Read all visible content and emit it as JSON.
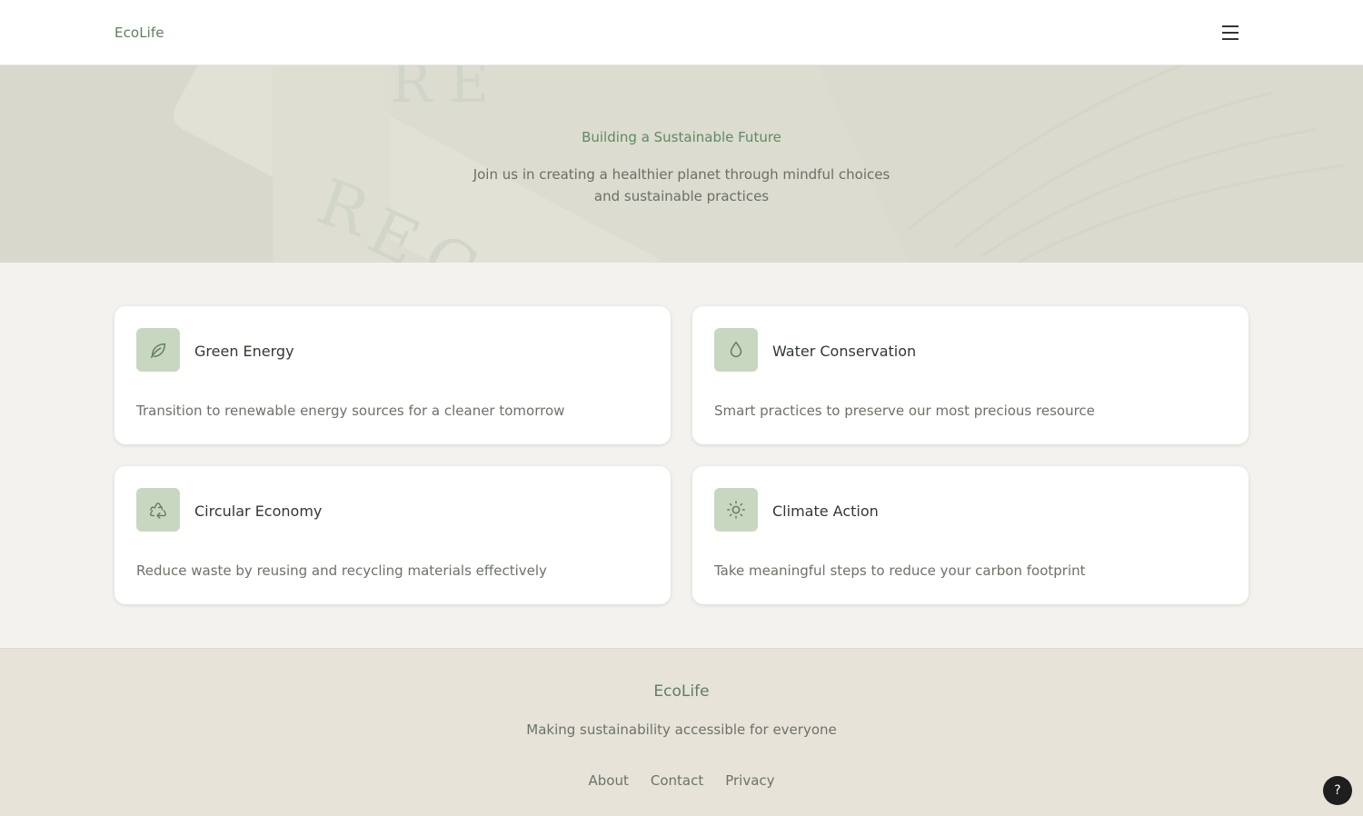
{
  "header": {
    "logo": "EcoLife"
  },
  "hero": {
    "title": "Building a Sustainable Future",
    "subtitle": "Join us in creating a healthier planet through mindful choices and sustainable practices"
  },
  "cards": [
    {
      "icon": "leaf-icon",
      "title": "Green Energy",
      "description": "Transition to renewable energy sources for a cleaner tomorrow"
    },
    {
      "icon": "water-drop-icon",
      "title": "Water Conservation",
      "description": "Smart practices to preserve our most precious resource"
    },
    {
      "icon": "recycle-icon",
      "title": "Circular Economy",
      "description": "Reduce waste by reusing and recycling materials effectively"
    },
    {
      "icon": "sun-icon",
      "title": "Climate Action",
      "description": "Take meaningful steps to reduce your carbon footprint"
    }
  ],
  "footer": {
    "brand": "EcoLife",
    "tagline": "Making sustainability accessible for everyone",
    "links": [
      "About",
      "Contact",
      "Privacy"
    ]
  },
  "help": {
    "label": "?"
  },
  "colors": {
    "accent": "#5f8a5f",
    "icon_bg": "#c8d8c0",
    "background": "#f3f2ee",
    "footer_bg": "#e7e3d9"
  }
}
